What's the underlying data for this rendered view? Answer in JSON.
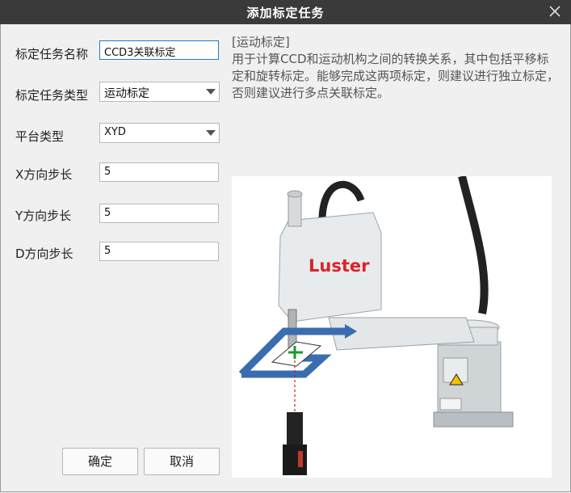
{
  "window": {
    "title": "添加标定任务",
    "close_icon": "close-icon"
  },
  "form": {
    "task_name_label": "标定任务名称",
    "task_name_value": "CCD3关联标定",
    "task_type_label": "标定任务类型",
    "task_type_value": "运动标定",
    "platform_label": "平台类型",
    "platform_value": "XYD",
    "x_step_label": "X方向步长",
    "x_step_value": "5",
    "y_step_label": "Y方向步长",
    "y_step_value": "5",
    "d_step_label": "D方向步长",
    "d_step_value": "5"
  },
  "description": {
    "heading": "[运动标定]",
    "body": "用于计算CCD和运动机构之间的转换关系，其中包括平移标定和旋转标定。能够完成这两项标定，则建议进行独立标定，否则建议进行多点关联标定。"
  },
  "illustration": {
    "brand_text": "Luster",
    "brand_color": "#d8232a",
    "arrow_color": "#3a6db0"
  },
  "buttons": {
    "ok_label": "确定",
    "cancel_label": "取消"
  }
}
